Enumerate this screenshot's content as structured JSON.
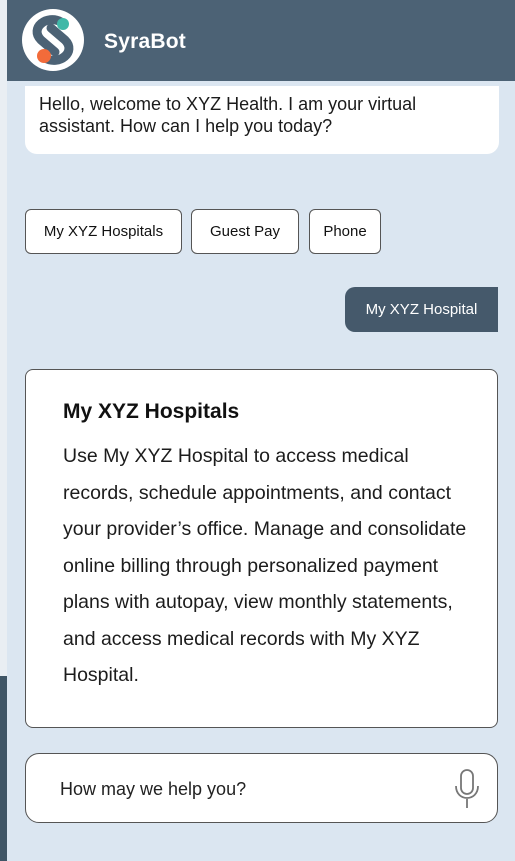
{
  "header": {
    "brand": "SyraBot",
    "logo_icon": "syrabot-logo-icon"
  },
  "bot_message": {
    "text": "Hello, welcome to XYZ Health. I am your virtual assistant. How can I help you today?"
  },
  "quick_replies": [
    {
      "label": "My XYZ Hospitals"
    },
    {
      "label": "Guest Pay"
    },
    {
      "label": "Phone"
    }
  ],
  "user_message": {
    "text": "My XYZ Hospital"
  },
  "info_card": {
    "title": "My XYZ Hospitals",
    "body": "Use My XYZ Hospital to access medical records, schedule appointments, and contact your provider’s office. Manage and consolidate online billing through personalized payment plans with autopay, view monthly statements, and access medical records with My XYZ Hospital."
  },
  "composer": {
    "placeholder": "How may we help you?",
    "mic_icon": "microphone-icon"
  },
  "colors": {
    "header": "#4c6275",
    "chat_background": "#dbe6f1",
    "user_bubble": "#45596b",
    "logo_orange": "#f26b3a",
    "logo_teal": "#3fb8a8"
  }
}
